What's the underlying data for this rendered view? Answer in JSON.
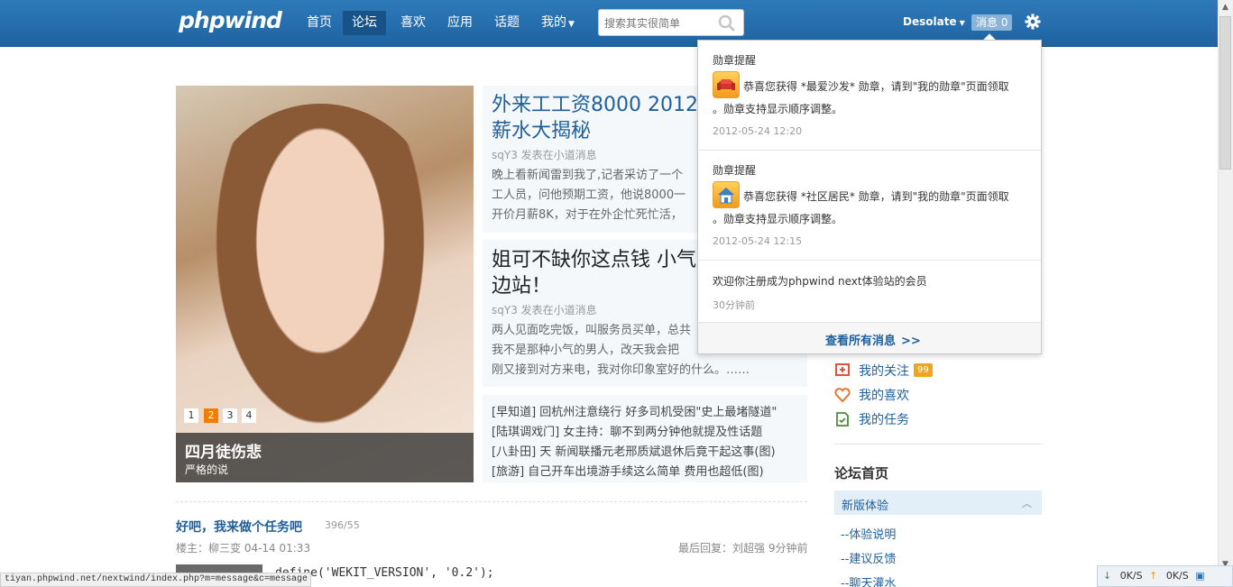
{
  "header": {
    "logo": "phpwind",
    "nav": [
      "首页",
      "论坛",
      "喜欢",
      "应用",
      "话题",
      "我的"
    ],
    "search_placeholder": "搜索其实很简单",
    "username": "Desolate",
    "messages_label": "消息",
    "messages_count": "0"
  },
  "slideshow": {
    "pages": [
      "1",
      "2",
      "3",
      "4"
    ],
    "active_page": 2,
    "caption_title": "四月徒伤悲",
    "caption_sub": "严格的说"
  },
  "articles": [
    {
      "title_line1": "外来工工资8000 2012",
      "title_line2": "薪水大揭秘",
      "meta": "sqY3 发表在小道消息",
      "body": [
        "晚上看新闻雷到我了,记者采访了一个",
        "工人员，问他预期工资，他说8000一",
        "开价月薪8K，对于在外企忙死忙活，"
      ]
    },
    {
      "title_line1": "姐可不缺你这点钱 小气",
      "title_line2": "边站！",
      "meta": "sqY3 发表在小道消息",
      "body": [
        "两人见面吃完饭，叫服务员买单，总共",
        "我不是那种小气的男人，改天我会把",
        "刚又接到对方来电，我对你印象室好的什么。……"
      ]
    }
  ],
  "links": [
    "[早知道] 回杭州注意绕行 好多司机受困\"史上最堵隧道\"",
    "[陆琪调戏门] 女主持：聊不到两分钟他就提及性话题",
    "[八卦田] 天 新闻联播元老邢质斌退休后竟干起这事(图)",
    "[旅游] 自己开车出境游手续这么简单 费用也超低(图)"
  ],
  "post": {
    "title": "好吧，我来做个任务吧",
    "count": "396/55",
    "author": "楼主：柳三变  04-14 01:33",
    "last_reply": "最后回复：刘超强 9分钟前",
    "code": "define('WEKIT_VERSION', '0.2');"
  },
  "sidebar": {
    "links": [
      "我的关注",
      "我的喜欢",
      "我的任务"
    ],
    "follow_badge": "99",
    "forum_home": "论坛首页",
    "new_version": "新版体验",
    "subitems": [
      "--体验说明",
      "--建议反馈",
      "--聊天灌水"
    ]
  },
  "notifications": {
    "items": [
      {
        "head": "勋章提醒",
        "line1": "恭喜您获得 *最爱沙发* 勋章，请到\"我的勋章\"页面领取",
        "line2": "。勋章支持显示顺序调整。",
        "time": "2012-05-24 12:20"
      },
      {
        "head": "勋章提醒",
        "line1": "恭喜您获得 *社区居民* 勋章，请到\"我的勋章\"页面领取",
        "line2": "。勋章支持显示顺序调整。",
        "time": "2012-05-24 12:15"
      },
      {
        "text": "欢迎你注册成为phpwind next体验站的会员",
        "time": "30分钟前"
      }
    ],
    "view_all": "查看所有消息"
  },
  "statusbar": {
    "url": "tiyan.phpwind.net/nextwind/index.php?m=message&c=message",
    "down": "0K/S",
    "up": "0K/S"
  }
}
